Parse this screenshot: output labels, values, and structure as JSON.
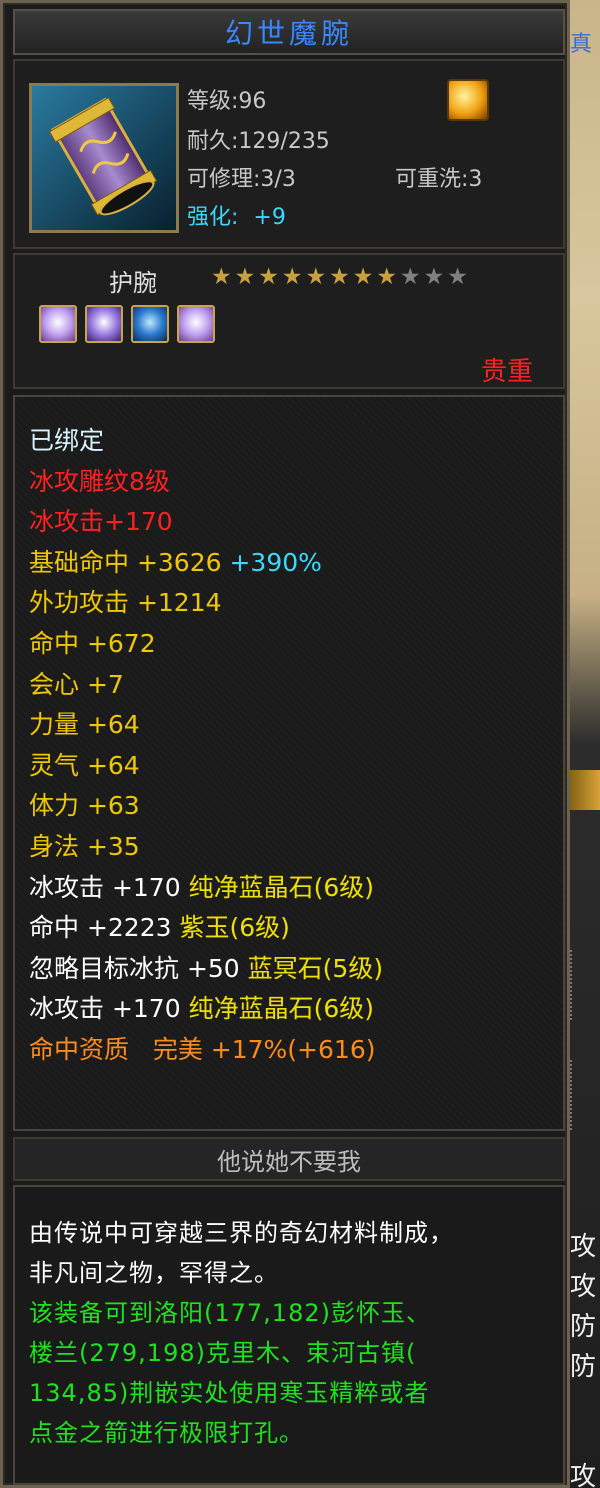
{
  "title": "幻世魔腕",
  "header": {
    "level": "等级:96",
    "durability": "耐久:129/235",
    "repairable": "可修理:3/3",
    "rewashable": "可重洗:3",
    "enhance_label": "强化:",
    "enhance_value": "+9"
  },
  "item_type": "护腕",
  "stars": {
    "filled": 8,
    "total": 11
  },
  "rarity": "贵重",
  "attributes": [
    {
      "text": "已绑定",
      "color": "#d8f4ff"
    },
    {
      "text": "冰攻雕纹8级",
      "color": "#ff2020"
    },
    {
      "text": "冰攻击+170",
      "color": "#ff2020"
    },
    {
      "text": "基础命中 +3626",
      "color": "#f0c800",
      "extra": " +390%",
      "extra_color": "#3ad8ff"
    },
    {
      "text": "外功攻击 +1214",
      "color": "#f0c800"
    },
    {
      "text": "命中 +672",
      "color": "#f0c800"
    },
    {
      "text": "会心 +7",
      "color": "#f0c800"
    },
    {
      "text": "力量 +64",
      "color": "#f0c800"
    },
    {
      "text": "灵气 +64",
      "color": "#f0c800"
    },
    {
      "text": "体力 +63",
      "color": "#f0c800"
    },
    {
      "text": "身法 +35",
      "color": "#f0c800"
    },
    {
      "text": "冰攻击 +170",
      "color": "#ffffff",
      "extra": " 纯净蓝晶石(6级)",
      "extra_color": "#f0e000"
    },
    {
      "text": "命中 +2223",
      "color": "#ffffff",
      "extra": " 紫玉(6级)",
      "extra_color": "#f0e000"
    },
    {
      "text": "忽略目标冰抗 +50",
      "color": "#ffffff",
      "extra": " 蓝冥石(5级)",
      "extra_color": "#f0e000"
    },
    {
      "text": "冰攻击 +170",
      "color": "#ffffff",
      "extra": " 纯净蓝晶石(6级)",
      "extra_color": "#f0e000"
    },
    {
      "text": "命中资质   完美 +17%(+616)",
      "color": "#ff8c1a"
    }
  ],
  "owner": "他说她不要我",
  "description": [
    {
      "text": "由传说中可穿越三界的奇幻材料制成，",
      "color": "#ffffff"
    },
    {
      "text": "非凡间之物，罕得之。",
      "color": "#ffffff"
    },
    {
      "text": "该装备可到洛阳(177,182)彭怀玉、",
      "color": "#20e020"
    },
    {
      "text": "楼兰(279,198)克里木、束河古镇(",
      "color": "#20e020"
    },
    {
      "text": "134,85)荆嵌实处使用寒玉精粹或者",
      "color": "#20e020"
    },
    {
      "text": "点金之箭进行极限打孔。",
      "color": "#20e020"
    }
  ],
  "colors": {
    "title": "#3a86ff",
    "star_filled": "#c8a040",
    "star_empty": "#808080",
    "enhance": "#3ad8ff",
    "rarity": "#ff2020"
  },
  "icons": {
    "item": "bracer-item-icon",
    "quality": "gold-quality-icon"
  },
  "background_ui": [
    "真",
    "攻",
    "攻",
    "防",
    "防",
    "攻"
  ]
}
